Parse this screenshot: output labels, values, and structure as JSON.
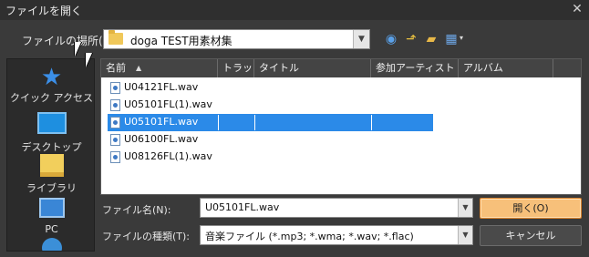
{
  "dialog": {
    "title": "ファイルを開く",
    "close_glyph": "✕"
  },
  "location": {
    "label": "ファイルの場所(I):",
    "value": "doga TEST用素材集",
    "icon": "folder-icon"
  },
  "toolbar": {
    "icons": [
      "back-icon",
      "up-folder-icon",
      "new-folder-icon",
      "view-menu-icon"
    ],
    "glyphs": {
      "back": "◉",
      "up": "⬏",
      "new_folder": "▰",
      "view": "▦",
      "view_arrow": "▾"
    }
  },
  "places": [
    {
      "label": "クイック アクセス",
      "icon": "star-icon",
      "glyph": "★"
    },
    {
      "label": "デスクトップ",
      "icon": "desktop-icon"
    },
    {
      "label": "ライブラリ",
      "icon": "library-icon"
    },
    {
      "label": "PC",
      "icon": "pc-icon"
    },
    {
      "label": "",
      "icon": "network-icon"
    }
  ],
  "list": {
    "columns": [
      "名前",
      "トラック",
      "タイトル",
      "参加アーティスト",
      "アルバム"
    ],
    "sort_glyph": "▲",
    "files": [
      {
        "name": "U04121FL.wav",
        "selected": false
      },
      {
        "name": "U05101FL(1).wav",
        "selected": false
      },
      {
        "name": "U05101FL.wav",
        "selected": true
      },
      {
        "name": "U06100FL.wav",
        "selected": false
      },
      {
        "name": "U08126FL(1).wav",
        "selected": false
      }
    ]
  },
  "filename": {
    "label": "ファイル名(N):",
    "value": "U05101FL.wav"
  },
  "filetype": {
    "label": "ファイルの種類(T):",
    "value": "音楽ファイル (*.mp3; *.wma; *.wav; *.flac)"
  },
  "buttons": {
    "open": "開く(O)",
    "cancel": "キャンセル"
  },
  "dropdown_glyph": "▼",
  "colors": {
    "selection": "#2b8ae8",
    "open_button": "#f7c07a",
    "background": "#3a3a3a"
  }
}
